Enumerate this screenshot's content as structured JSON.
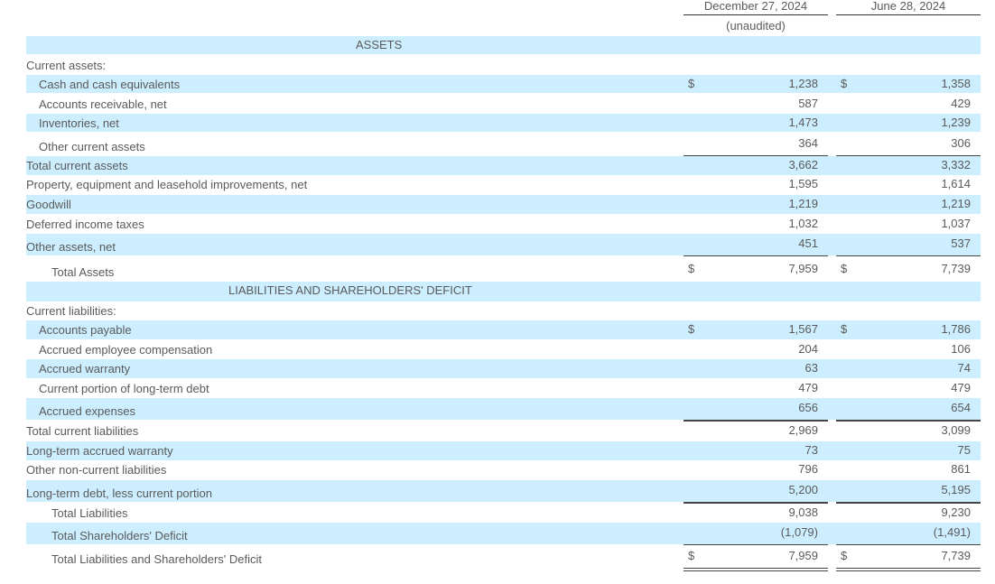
{
  "header": {
    "col1_date": "December 27, 2024",
    "col1_note": "(unaudited)",
    "col2_date": "June 28, 2024"
  },
  "currency_symbol": "$",
  "rows": [
    {
      "label": "ASSETS",
      "kind": "section",
      "indent": 365,
      "shaded": true
    },
    {
      "label": "Current assets:",
      "kind": "plain",
      "indent": 0,
      "shaded": false
    },
    {
      "label": "Cash and cash equivalents",
      "v1": "1,238",
      "v2": "1,358",
      "cur": true,
      "indent": 14,
      "shaded": true
    },
    {
      "label": "Accounts receivable, net",
      "v1": "587",
      "v2": "429",
      "indent": 14,
      "shaded": false
    },
    {
      "label": "Inventories, net",
      "v1": "1,473",
      "v2": "1,239",
      "indent": 14,
      "shaded": true
    },
    {
      "label": "Other current assets",
      "v1": "364",
      "v2": "306",
      "indent": 14,
      "shaded": false
    },
    {
      "label": "Total current assets",
      "v1": "3,662",
      "v2": "3,332",
      "indent": 0,
      "shaded": true
    },
    {
      "label": "Property, equipment and leasehold improvements, net",
      "v1": "1,595",
      "v2": "1,614",
      "indent": 0,
      "shaded": false
    },
    {
      "label": "Goodwill",
      "v1": "1,219",
      "v2": "1,219",
      "indent": 0,
      "shaded": true
    },
    {
      "label": "Deferred income taxes",
      "v1": "1,032",
      "v2": "1,037",
      "indent": 0,
      "shaded": false
    },
    {
      "label": "Other assets, net",
      "v1": "451",
      "v2": "537",
      "indent": 0,
      "shaded": true
    },
    {
      "label": "Total Assets",
      "v1": "7,959",
      "v2": "7,739",
      "cur": true,
      "indent": 28,
      "shaded": false
    },
    {
      "label": "LIABILITIES AND SHAREHOLDERS' DEFICIT",
      "kind": "section",
      "indent": 224,
      "shaded": true
    },
    {
      "label": "Current liabilities:",
      "kind": "plain",
      "indent": 0,
      "shaded": false
    },
    {
      "label": "Accounts payable",
      "v1": "1,567",
      "v2": "1,786",
      "cur": true,
      "indent": 14,
      "shaded": true
    },
    {
      "label": "Accrued employee compensation",
      "v1": "204",
      "v2": "106",
      "indent": 14,
      "shaded": false
    },
    {
      "label": "Accrued warranty",
      "v1": "63",
      "v2": "74",
      "indent": 14,
      "shaded": true
    },
    {
      "label": "Current portion of long-term debt",
      "v1": "479",
      "v2": "479",
      "indent": 14,
      "shaded": false
    },
    {
      "label": "Accrued expenses",
      "v1": "656",
      "v2": "654",
      "indent": 14,
      "shaded": true
    },
    {
      "label": "Total current liabilities",
      "v1": "2,969",
      "v2": "3,099",
      "indent": 0,
      "shaded": false
    },
    {
      "label": "Long-term accrued warranty",
      "v1": "73",
      "v2": "75",
      "indent": 0,
      "shaded": true
    },
    {
      "label": "Other non-current liabilities",
      "v1": "796",
      "v2": "861",
      "indent": 0,
      "shaded": false
    },
    {
      "label": "Long-term debt, less current portion",
      "v1": "5,200",
      "v2": "5,195",
      "indent": 0,
      "shaded": true
    },
    {
      "label": "Total Liabilities",
      "v1": "9,038",
      "v2": "9,230",
      "indent": 28,
      "shaded": false
    },
    {
      "label": "Total Shareholders' Deficit",
      "v1": "(1,079)",
      "v2": "(1,491)",
      "indent": 28,
      "shaded": true
    },
    {
      "label": "Total Liabilities and Shareholders' Deficit",
      "v1": "7,959",
      "v2": "7,739",
      "cur": true,
      "indent": 28,
      "shaded": false
    }
  ]
}
